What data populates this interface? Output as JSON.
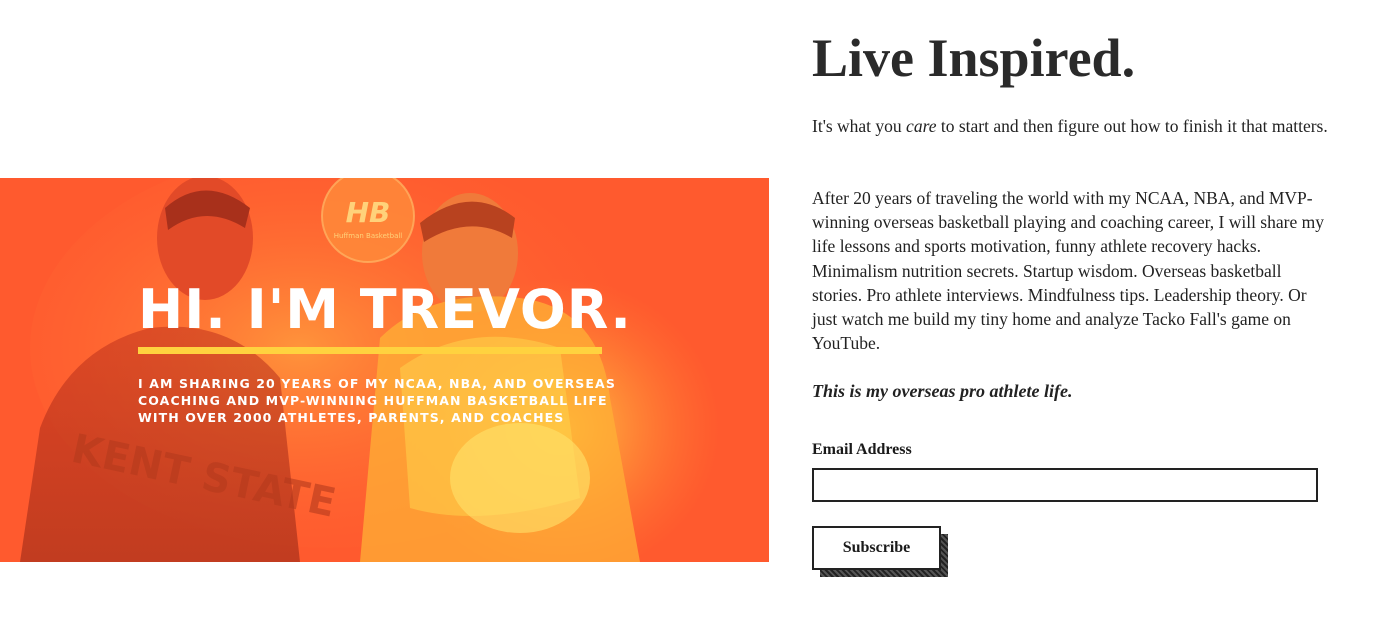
{
  "hero": {
    "title": "HI. I'M TREVOR.",
    "subtitle": "I AM SHARING 20 YEARS OF MY NCAA, NBA, AND OVERSEAS COACHING AND MVP-WINNING HUFFMAN BASKETBALL LIFE WITH OVER 2000 ATHLETES, PARENTS, AND COACHES",
    "logo_text": "HB",
    "logo_caption": "Huffman Basketball",
    "jersey_text": "KENT STATE",
    "colors": {
      "overlay": "#ff5a30",
      "accent": "#ffd23f"
    }
  },
  "content": {
    "title": "Live Inspired.",
    "intro_before": "It's what you ",
    "intro_emphasis": "care",
    "intro_after": " to start and then figure out how to finish it that matters.",
    "story": "After 20 years of traveling the world with my NCAA, NBA, and MVP-winning overseas basketball playing and coaching career, I will share my life lessons and sports motivation, funny athlete recovery hacks. Minimalism nutrition secrets. Startup wisdom. Overseas basketball stories. Pro athlete interviews. Mindfulness tips. Leadership theory. Or just watch me build my tiny home and analyze Tacko Fall's game on YouTube.",
    "tagline": "This is my overseas pro athlete life."
  },
  "form": {
    "email_label": "Email Address",
    "email_value": "",
    "email_placeholder": "",
    "subscribe_label": "Subscribe"
  }
}
